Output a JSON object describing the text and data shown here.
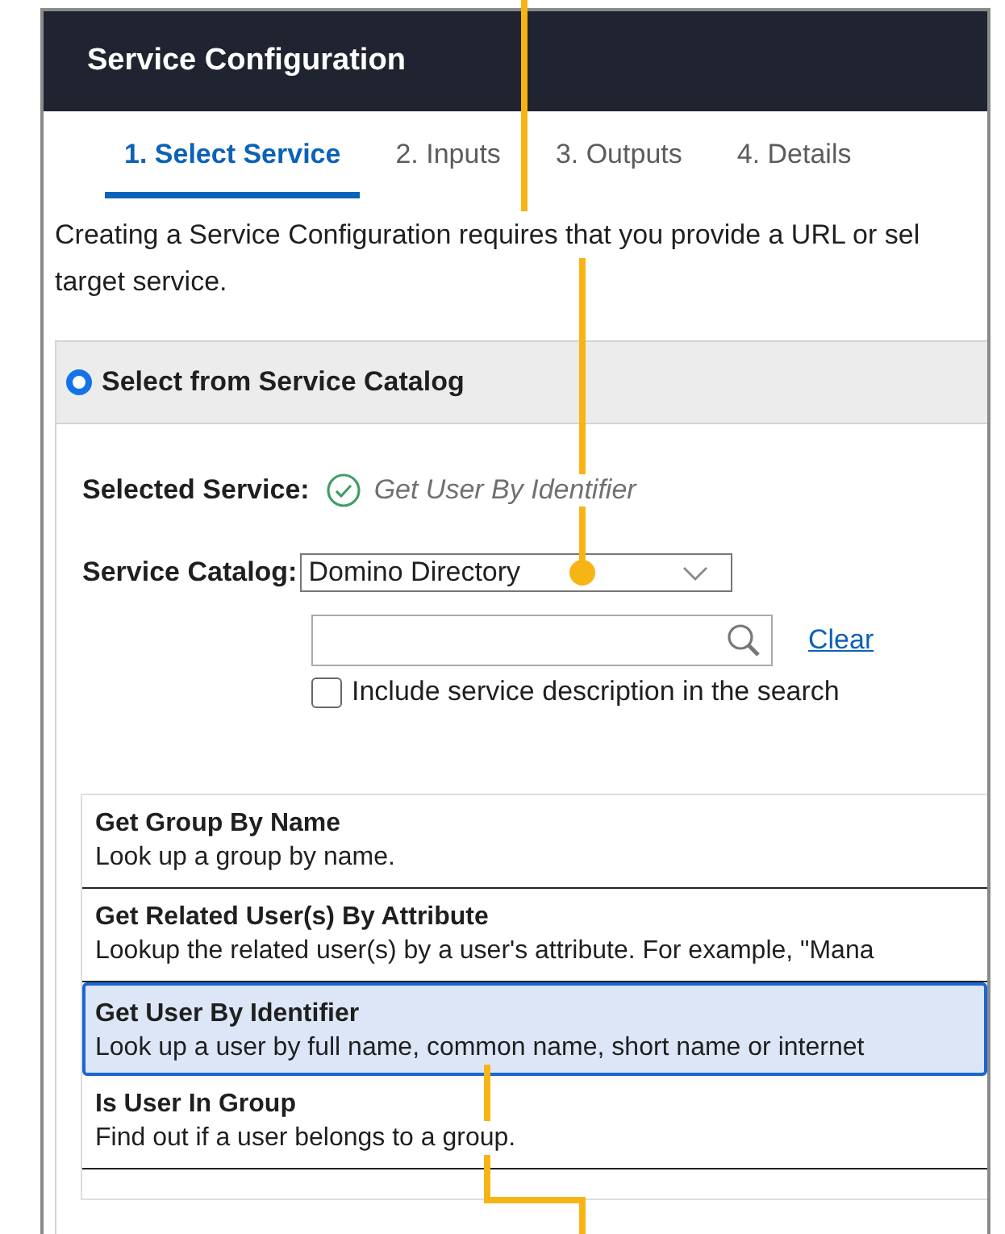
{
  "window": {
    "title": "Service Configuration"
  },
  "tabs": [
    {
      "label": "1. Select Service",
      "selected": true
    },
    {
      "label": "2. Inputs",
      "selected": false
    },
    {
      "label": "3. Outputs",
      "selected": false
    },
    {
      "label": "4. Details",
      "selected": false
    }
  ],
  "intro_lines": [
    "Creating a Service Configuration requires that you provide a URL or sel",
    "target service."
  ],
  "catalog_section": {
    "label": "Select from Service Catalog",
    "selected": true,
    "selected_service": {
      "label": "Selected Service:",
      "value": "Get User By Identifier"
    },
    "service_catalog": {
      "label": "Service Catalog:",
      "value": "Domino Directory"
    },
    "search": {
      "clear_link": "Clear"
    },
    "include_description": {
      "label": "Include service description in the search",
      "checked": false
    },
    "services": [
      {
        "name": "Get Group By Name",
        "description": "Look up a group by name.",
        "selected": false
      },
      {
        "name": "Get Related User(s) By Attribute",
        "description": "Lookup the related user(s) by a user's attribute. For example, \"Mana",
        "selected": false
      },
      {
        "name": "Get User By Identifier",
        "description": "Look up a user by full name, common name, short name or internet",
        "selected": true
      },
      {
        "name": "Is User In Group",
        "description": "Find out if a user belongs to a group.",
        "selected": false
      }
    ]
  }
}
